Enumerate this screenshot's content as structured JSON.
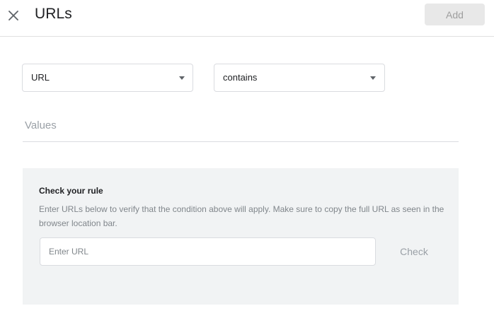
{
  "header": {
    "close_icon": "close-icon",
    "title": "URLs",
    "add_label": "Add"
  },
  "rule": {
    "field_select": {
      "value": "URL",
      "icon": "dropdown-caret-icon"
    },
    "operator_select": {
      "value": "contains",
      "icon": "dropdown-caret-icon"
    },
    "values_placeholder": "Values"
  },
  "check": {
    "title": "Check your rule",
    "description": "Enter URLs below to verify that the condition above will apply. Make sure to copy the full URL as seen in the browser location bar.",
    "url_placeholder": "Enter URL",
    "button_label": "Check"
  },
  "colors": {
    "add_button_bg": "#e8e8e8",
    "panel_bg": "#f1f3f4",
    "border": "#dadce0",
    "muted_text": "#9aa0a6"
  }
}
